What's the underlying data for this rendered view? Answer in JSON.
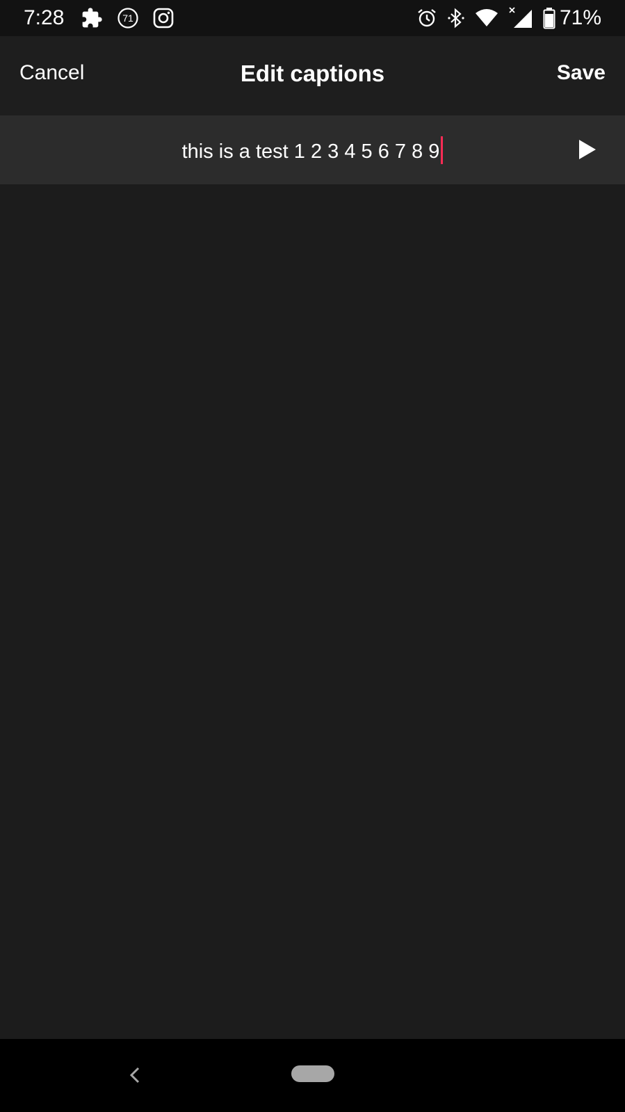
{
  "status_bar": {
    "time": "7:28",
    "notification_badge": "71",
    "battery_percent": "71%",
    "icons_left": [
      "puzzle-icon",
      "notification-count-icon",
      "instagram-icon"
    ],
    "icons_right": [
      "alarm-icon",
      "bluetooth-icon",
      "wifi-icon",
      "signal-icon",
      "battery-icon"
    ]
  },
  "header": {
    "cancel_label": "Cancel",
    "title": "Edit captions",
    "save_label": "Save"
  },
  "caption": {
    "value": "this is a test 1 2 3 4 5 6 7 8 9"
  },
  "colors": {
    "background": "#1c1c1c",
    "caption_row": "#2c2c2c",
    "caret": "#fe2c55",
    "status_bar": "#121212",
    "nav_bar": "#000000"
  },
  "nav_bar": {
    "icons": [
      "back-icon",
      "home-pill-icon"
    ]
  }
}
